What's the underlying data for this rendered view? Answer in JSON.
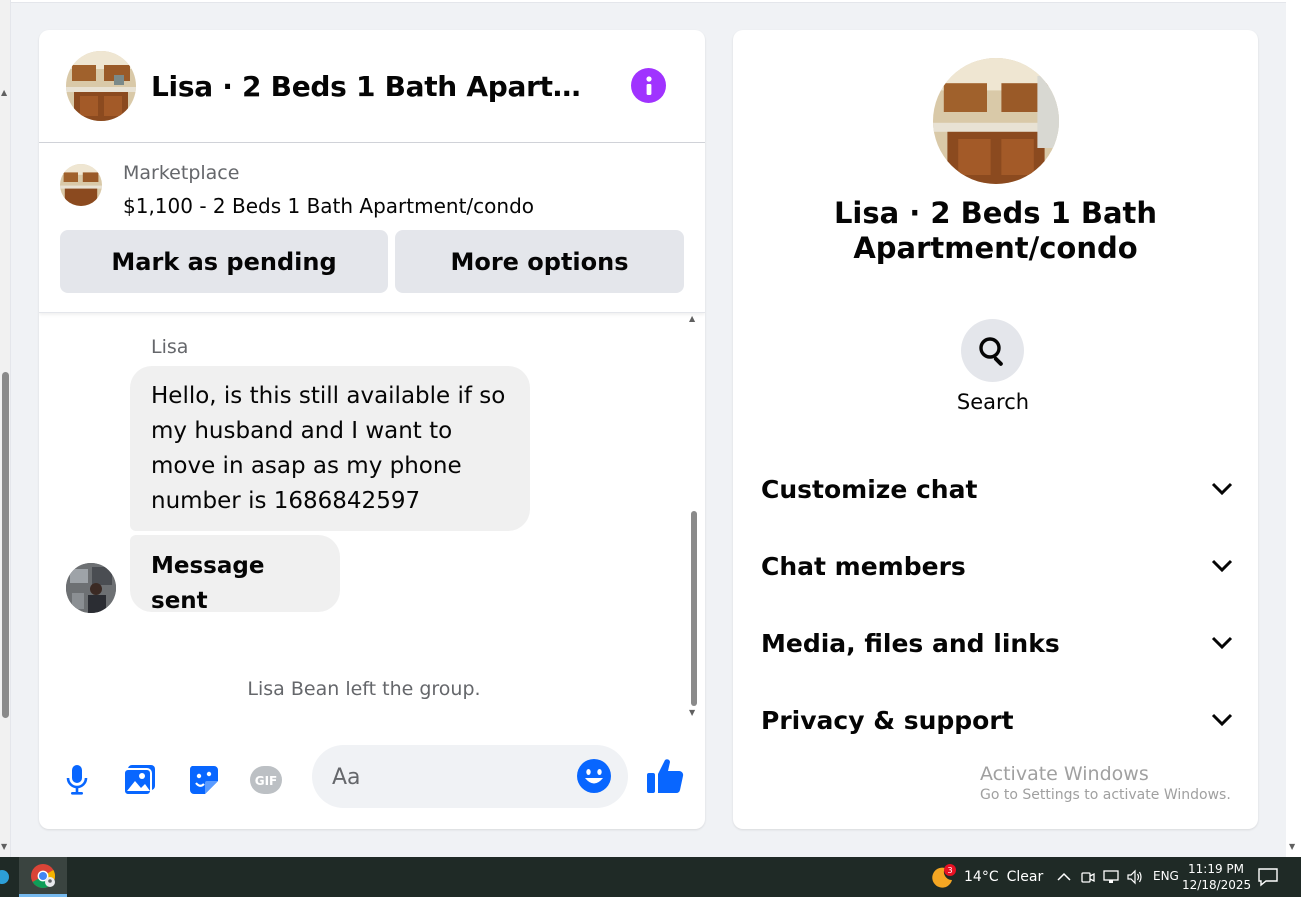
{
  "chat": {
    "title": "Lisa · 2 Beds 1 Bath Apartment/condo",
    "listing": {
      "category_label": "Marketplace",
      "title": "$1,100 - 2 Beds 1 Bath Apartment/condo"
    },
    "actions": {
      "mark_pending": "Mark as pending",
      "more_options": "More options"
    },
    "messages": {
      "sender": "Lisa",
      "first_text": "Hello, is this still available if so my husband and I want to move in asap as my phone number is 1686842597",
      "second_text": "Message sent",
      "system_notice": "Lisa Bean left the group."
    },
    "composer": {
      "placeholder": "Aa",
      "icons": [
        "microphone-icon",
        "image-icon",
        "sticker-icon",
        "gif-icon",
        "emoji-icon",
        "thumbs-up-icon"
      ],
      "gif_label": "GIF"
    }
  },
  "info_panel": {
    "title": "Lisa · 2 Beds 1 Bath Apartment/condo",
    "search_label": "Search",
    "sections": [
      {
        "label": "Customize chat"
      },
      {
        "label": "Chat members"
      },
      {
        "label": "Media, files and links"
      },
      {
        "label": "Privacy & support"
      }
    ],
    "watermark": {
      "line1": "Activate Windows",
      "line2": "Go to Settings to activate Windows."
    }
  },
  "taskbar": {
    "weather": {
      "temp": "14°C",
      "condition": "Clear",
      "badge": "3"
    },
    "language": "ENG",
    "time": "11:19 PM",
    "date": "12/18/2025"
  },
  "colors": {
    "accent_blue": "#0866ff",
    "info_purple": "#a033ff",
    "taskbar": "#1f2a26"
  }
}
